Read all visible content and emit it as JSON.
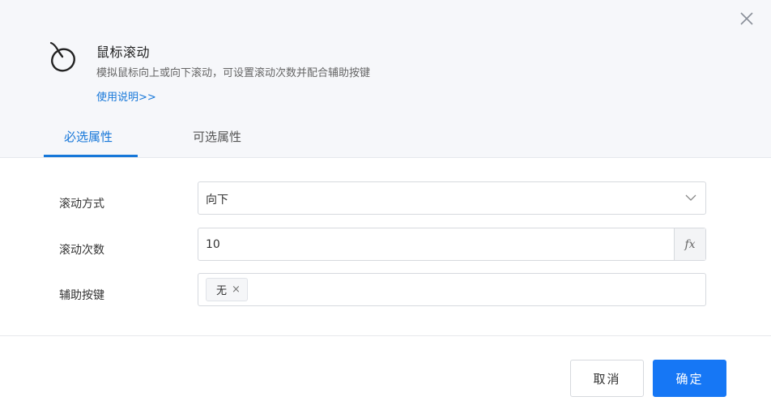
{
  "dialog": {
    "title": "鼠标滚动",
    "description": "模拟鼠标向上或向下滚动，可设置滚动次数并配合辅助按键",
    "help_link": "使用说明>>"
  },
  "tabs": [
    {
      "label": "必选属性",
      "active": true
    },
    {
      "label": "可选属性",
      "active": false
    }
  ],
  "form": {
    "scroll_mode": {
      "label": "滚动方式",
      "value": "向下"
    },
    "scroll_count": {
      "label": "滚动次数",
      "value": "10",
      "fx_label": "fx"
    },
    "modifier_keys": {
      "label": "辅助按键",
      "tags": [
        {
          "label": "无",
          "remove": "×"
        }
      ]
    }
  },
  "footer": {
    "cancel_label": "取消",
    "ok_label": "确定"
  },
  "colors": {
    "accent": "#1677f5",
    "link": "#1677d9"
  }
}
